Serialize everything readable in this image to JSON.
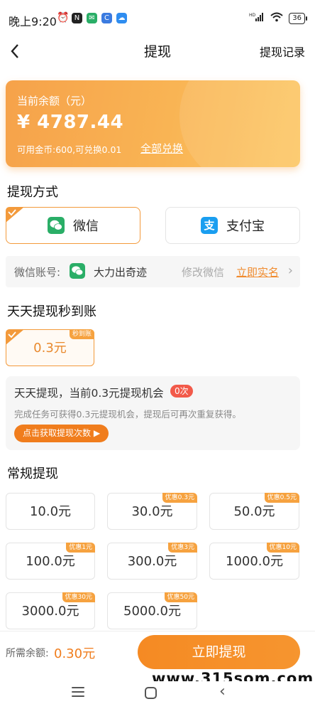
{
  "status_bar": {
    "time": "晚上9:20",
    "battery": "36",
    "signal_tag": "HD"
  },
  "nav": {
    "title": "提现",
    "record_link": "提现记录"
  },
  "balance": {
    "label": "当前余额（元）",
    "amount": "¥ 4787.44",
    "gold_info": "可用金币:600,可兑换0.01",
    "exchange_all": "全部兑换"
  },
  "method_section": {
    "title": "提现方式",
    "options": [
      {
        "label": "微信",
        "icon": "wechat-icon",
        "selected": true
      },
      {
        "label": "支付宝",
        "icon": "alipay-icon",
        "selected": false
      }
    ],
    "account": {
      "label": "微信账号:",
      "name": "大力出奇迹",
      "modify": "修改微信",
      "verify": "立即实名"
    }
  },
  "daily_section": {
    "title": "天天提现秒到账",
    "option": {
      "label": "0.3元",
      "badge": "秒到账",
      "selected": true
    },
    "info": {
      "title": "天天提现，当前0.3元提现机会",
      "count": "0次",
      "desc": "完成任务可获得0.3元提现机会，提现后可再次重复获得。",
      "button": "点击获取提现次数 ▶"
    }
  },
  "regular_section": {
    "title": "常规提现",
    "options": [
      {
        "label": "10.0元",
        "badge": ""
      },
      {
        "label": "30.0元",
        "badge": "优惠0.3元"
      },
      {
        "label": "50.0元",
        "badge": "优惠0.5元"
      },
      {
        "label": "100.0元",
        "badge": "优惠1元"
      },
      {
        "label": "300.0元",
        "badge": "优惠3元"
      },
      {
        "label": "1000.0元",
        "badge": "优惠10元"
      },
      {
        "label": "3000.0元",
        "badge": "优惠30元"
      },
      {
        "label": "5000.0元",
        "badge": "优惠50元"
      }
    ]
  },
  "bottom": {
    "label": "所需余额:",
    "amount": "0.30元",
    "submit": "立即提现"
  },
  "watermark": "www.315som.com",
  "colors": {
    "accent": "#f07d1d",
    "card": "#f8ad50",
    "wechat": "#2aae67",
    "alipay": "#1a9ef0"
  }
}
